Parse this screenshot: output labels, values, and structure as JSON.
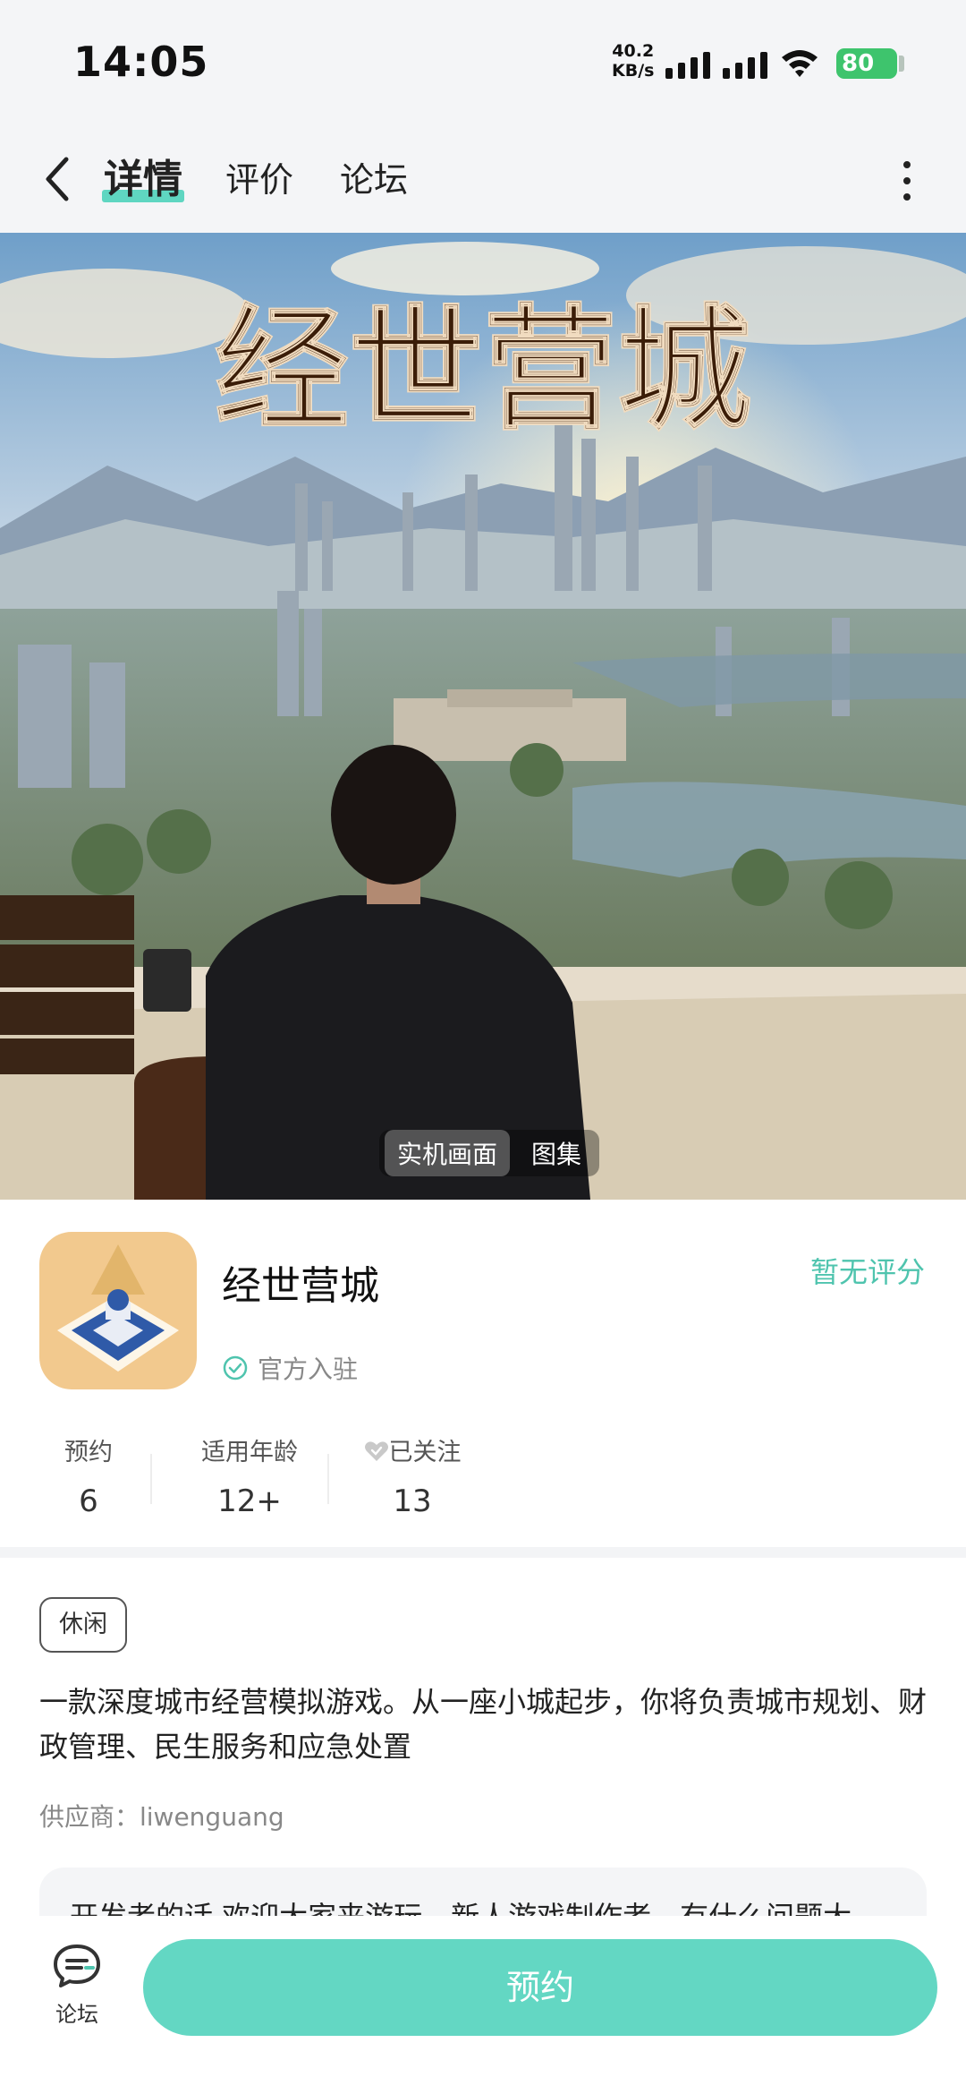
{
  "status_bar": {
    "time": "14:05",
    "net_speed_value": "40.2",
    "net_speed_unit": "KB/s",
    "battery": "80"
  },
  "nav": {
    "tabs": [
      {
        "label": "详情",
        "active": true
      },
      {
        "label": "评价",
        "active": false
      },
      {
        "label": "论坛",
        "active": false
      }
    ],
    "icons": {
      "back": "chevron-left-icon",
      "more": "more-vertical-icon"
    }
  },
  "hero": {
    "title_art": "经世营城",
    "media_tabs": [
      {
        "label": "实机画面",
        "active": true
      },
      {
        "label": "图集",
        "active": false
      }
    ]
  },
  "app": {
    "name": "经世营城",
    "official_label": "官方入驻",
    "rating_text": "暂无评分",
    "stats": [
      {
        "label": "预约",
        "value": "6"
      },
      {
        "label": "适用年龄",
        "value": "12+"
      },
      {
        "label": "已关注",
        "value": "13"
      }
    ]
  },
  "detail": {
    "tag": "休闲",
    "description": "一款深度城市经营模拟游戏。从一座小城起步，你将负责城市规划、财政管理、民生服务和应急处置",
    "supplier": "供应商：liwenguang",
    "developer_note": "开发者的话  欢迎大家来游玩，新人游戏制作者，有什么问题大"
  },
  "bottom": {
    "forum_label": "论坛",
    "reserve_label": "预约"
  },
  "colors": {
    "accent": "#63d7c3",
    "rating": "#4fc4ae",
    "battery": "#3ec46d"
  }
}
